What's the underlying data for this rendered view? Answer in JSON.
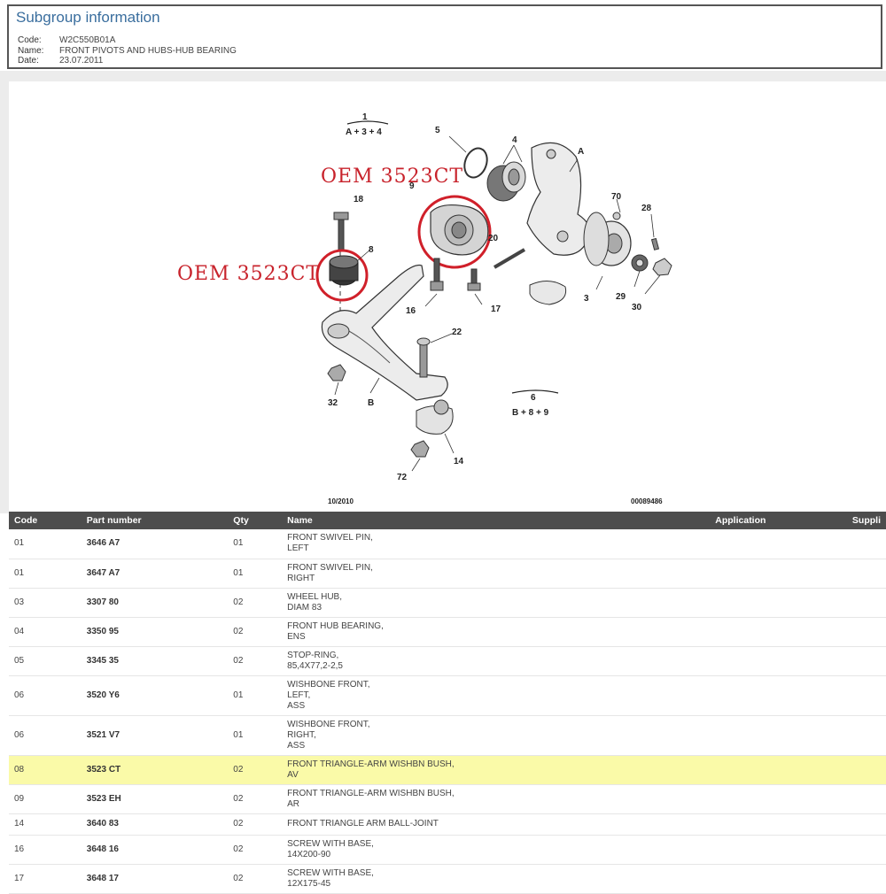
{
  "header": {
    "title": "Subgroup information",
    "meta": [
      {
        "key": "Code:",
        "value": "W2C550B01A"
      },
      {
        "key": "Name:",
        "value": "FRONT PIVOTS AND HUBS-HUB BEARING"
      },
      {
        "key": "Date:",
        "value": "23.07.2011"
      }
    ]
  },
  "diagram": {
    "callout_1": "OEM 3523CT",
    "callout_2": "OEM 3523CT",
    "group_1": {
      "num": "1",
      "formula": "A + 3 + 4"
    },
    "group_6": {
      "num": "6",
      "formula": "B + 8 + 9"
    },
    "labels": {
      "l5": "5",
      "l4": "4",
      "lA": "A",
      "l9": "9",
      "l70": "70",
      "l28": "28",
      "l18": "18",
      "l20": "20",
      "l8": "8",
      "l16": "16",
      "l17": "17",
      "l3": "3",
      "l29": "29",
      "l30": "30",
      "l22": "22",
      "l32": "32",
      "lB": "B",
      "l14": "14",
      "l72": "72"
    },
    "date": "10/2010",
    "ref": "00089486"
  },
  "table": {
    "headers": [
      "Code",
      "Part number",
      "Qty",
      "Name",
      "Application",
      "Suppli"
    ],
    "rows": [
      {
        "code": "01",
        "pn": "3646 A7",
        "qty": "01",
        "name1": "FRONT SWIVEL PIN,",
        "name2": "LEFT",
        "name3": ""
      },
      {
        "code": "01",
        "pn": "3647 A7",
        "qty": "01",
        "name1": "FRONT SWIVEL PIN,",
        "name2": "RIGHT",
        "name3": ""
      },
      {
        "code": "03",
        "pn": "3307 80",
        "qty": "02",
        "name1": "WHEEL HUB,",
        "name2": "DIAM 83",
        "name3": ""
      },
      {
        "code": "04",
        "pn": "3350 95",
        "qty": "02",
        "name1": "FRONT HUB BEARING,",
        "name2": "ENS",
        "name3": ""
      },
      {
        "code": "05",
        "pn": "3345 35",
        "qty": "02",
        "name1": "STOP-RING,",
        "name2": "85,4X77,2-2,5",
        "name3": ""
      },
      {
        "code": "06",
        "pn": "3520 Y6",
        "qty": "01",
        "name1": "WISHBONE FRONT,",
        "name2": "LEFT,",
        "name3": "ASS"
      },
      {
        "code": "06",
        "pn": "3521 V7",
        "qty": "01",
        "name1": "WISHBONE FRONT,",
        "name2": "RIGHT,",
        "name3": "ASS"
      },
      {
        "code": "08",
        "pn": "3523 CT",
        "qty": "02",
        "name1": "FRONT TRIANGLE-ARM WISHBN BUSH,",
        "name2": "AV",
        "name3": ""
      },
      {
        "code": "09",
        "pn": "3523 EH",
        "qty": "02",
        "name1": "FRONT TRIANGLE-ARM WISHBN BUSH,",
        "name2": "AR",
        "name3": ""
      },
      {
        "code": "14",
        "pn": "3640 83",
        "qty": "02",
        "name1": "FRONT TRIANGLE ARM BALL-JOINT",
        "name2": "",
        "name3": ""
      },
      {
        "code": "16",
        "pn": "3648 16",
        "qty": "02",
        "name1": "SCREW WITH BASE,",
        "name2": "14X200-90",
        "name3": ""
      },
      {
        "code": "17",
        "pn": "3648 17",
        "qty": "02",
        "name1": "SCREW WITH BASE,",
        "name2": "12X175-45",
        "name3": ""
      }
    ]
  }
}
